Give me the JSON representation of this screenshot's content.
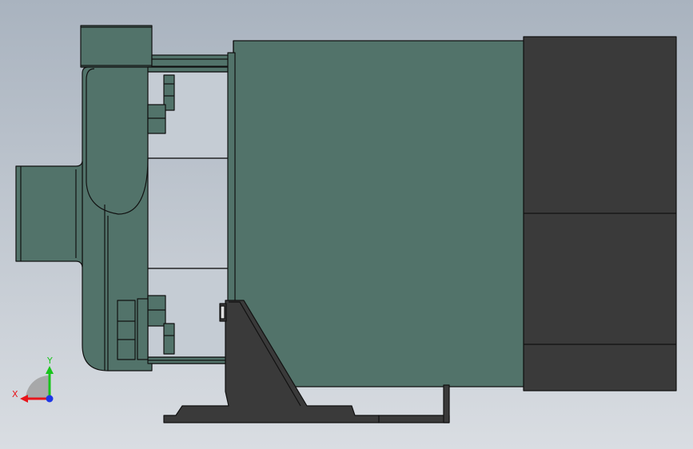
{
  "viewport": {
    "background_top": "#a9b3bf",
    "background_bottom": "#d9dde2"
  },
  "model": {
    "body_color": "#52736a",
    "motor_color": "#3a3a3a",
    "edge_color": "#111111",
    "highlight_color": "#e0e0e0"
  },
  "triad": {
    "x_label": "X",
    "y_label": "Y",
    "x_color": "#e8141a",
    "y_color": "#18c41b",
    "z_color": "#1d36e6",
    "plane_color": "#a0a0a0"
  }
}
